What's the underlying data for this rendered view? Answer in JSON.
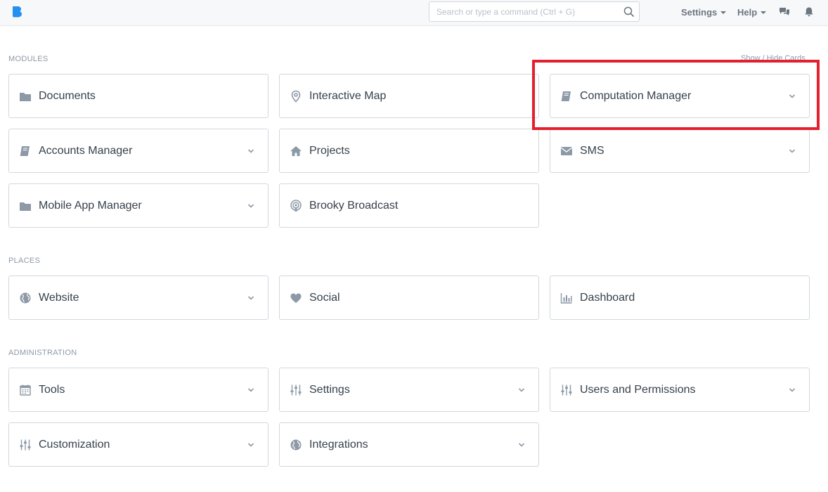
{
  "header": {
    "search": {
      "placeholder": "Search or type a command (Ctrl + G)",
      "value": ""
    },
    "settings_label": "Settings",
    "help_label": "Help"
  },
  "page": {
    "show_hide_label": "Show / Hide Cards"
  },
  "sections": {
    "modules": {
      "label": "MODULES",
      "cards": [
        {
          "label": "Documents",
          "icon": "folder-icon",
          "dropdown": false
        },
        {
          "label": "Interactive Map",
          "icon": "map-marker-icon",
          "dropdown": false
        },
        {
          "label": "Computation Manager",
          "icon": "book-icon",
          "dropdown": true
        },
        {
          "label": "Accounts Manager",
          "icon": "book-icon",
          "dropdown": true
        },
        {
          "label": "Projects",
          "icon": "home-icon",
          "dropdown": false
        },
        {
          "label": "SMS",
          "icon": "envelope-icon",
          "dropdown": true
        },
        {
          "label": "Mobile App Manager",
          "icon": "folder-icon",
          "dropdown": true
        },
        {
          "label": "Brooky Broadcast",
          "icon": "podcast-icon",
          "dropdown": false
        }
      ]
    },
    "places": {
      "label": "PLACES",
      "cards": [
        {
          "label": "Website",
          "icon": "globe-icon",
          "dropdown": true
        },
        {
          "label": "Social",
          "icon": "heart-icon",
          "dropdown": false
        },
        {
          "label": "Dashboard",
          "icon": "bar-chart-icon",
          "dropdown": false
        }
      ]
    },
    "administration": {
      "label": "ADMINISTRATION",
      "cards": [
        {
          "label": "Tools",
          "icon": "calendar-icon",
          "dropdown": true
        },
        {
          "label": "Settings",
          "icon": "sliders-icon",
          "dropdown": true
        },
        {
          "label": "Users and Permissions",
          "icon": "sliders-icon",
          "dropdown": true
        },
        {
          "label": "Customization",
          "icon": "sliders-icon",
          "dropdown": true
        },
        {
          "label": "Integrations",
          "icon": "globe-icon",
          "dropdown": true
        }
      ]
    }
  },
  "colors": {
    "accent": "#e3202e",
    "brand": "#2490ef",
    "icon_gray": "#8d99a6",
    "border": "#d1d8dd"
  }
}
